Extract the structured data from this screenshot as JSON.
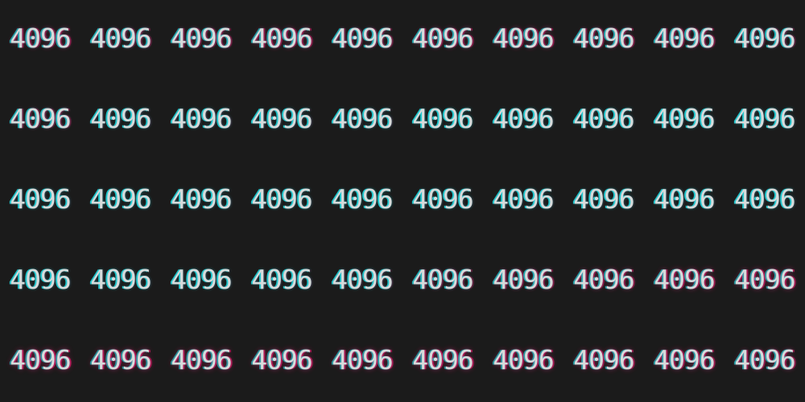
{
  "label": "4096",
  "rows": 5,
  "cols": 10,
  "colors": {
    "background": "#1b1b1b",
    "cyan": "#22e0e8",
    "magenta": "#e8186a",
    "white": "#e8ecec"
  },
  "magenta_intensity": [
    [
      0.55,
      0.35,
      0.45,
      0.6,
      0.4,
      0.55,
      0.6,
      0.5,
      0.5,
      0.3
    ],
    [
      0.35,
      0.1,
      0.1,
      0.1,
      0.1,
      0.0,
      0.05,
      0.05,
      0.05,
      0.05
    ],
    [
      0.05,
      0.0,
      0.05,
      0.05,
      0.0,
      0.05,
      0.05,
      0.05,
      0.05,
      0.05
    ],
    [
      0.05,
      0.05,
      0.05,
      0.1,
      0.15,
      0.35,
      0.5,
      0.6,
      0.7,
      0.75
    ],
    [
      0.85,
      0.8,
      0.8,
      0.8,
      0.75,
      0.8,
      0.75,
      0.7,
      0.7,
      0.65
    ]
  ]
}
